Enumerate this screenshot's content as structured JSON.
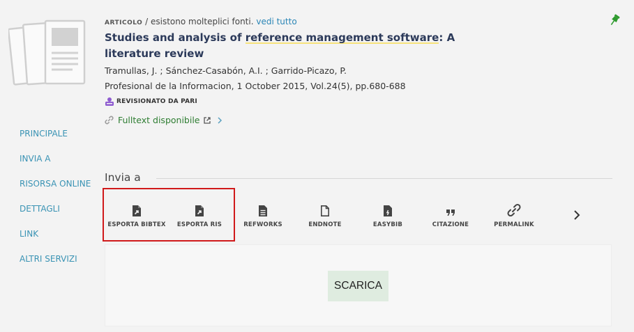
{
  "record": {
    "type_label": "ARTICOLO",
    "type_suffix": " / esistono molteplici fonti. ",
    "see_all": "vedi tutto",
    "title_part1": "Studies and analysis of ",
    "title_highlight": "reference management software",
    "title_part2": ": A literature review",
    "authors": "Tramullas, J. ; Sánchez-Casabón, A.I. ; Garrido-Picazo, P.",
    "source": "Profesional de la Informacion, 1 October 2015, Vol.24(5), pp.680-688",
    "peer_reviewed": "REVISIONATO DA PARI",
    "fulltext": "Fulltext disponibile"
  },
  "nav": {
    "items": [
      "PRINCIPALE",
      "INVIA A",
      "RISORSA ONLINE",
      "DETTAGLI",
      "LINK",
      "ALTRI SERVIZI"
    ]
  },
  "send_to": {
    "title": "Invia a",
    "actions": [
      {
        "label": "ESPORTA BIBTEX",
        "icon": "export-file-icon"
      },
      {
        "label": "ESPORTA RIS",
        "icon": "export-file-icon"
      },
      {
        "label": "REFWORKS",
        "icon": "document-lines-icon"
      },
      {
        "label": "ENDNOTE",
        "icon": "document-outline-icon"
      },
      {
        "label": "EASYBIB",
        "icon": "easybib-file-icon"
      },
      {
        "label": "CITAZIONE",
        "icon": "quote-icon"
      },
      {
        "label": "PERMALINK",
        "icon": "link-icon"
      }
    ],
    "download_label": "SCARICA"
  },
  "colors": {
    "accent_link": "#2b86b6",
    "title": "#2c3a5a",
    "fulltext_green": "#2e7d32",
    "highlight_red": "#d0191a",
    "download_bg": "#dfece0",
    "peer_purple": "#8e5bd0"
  }
}
